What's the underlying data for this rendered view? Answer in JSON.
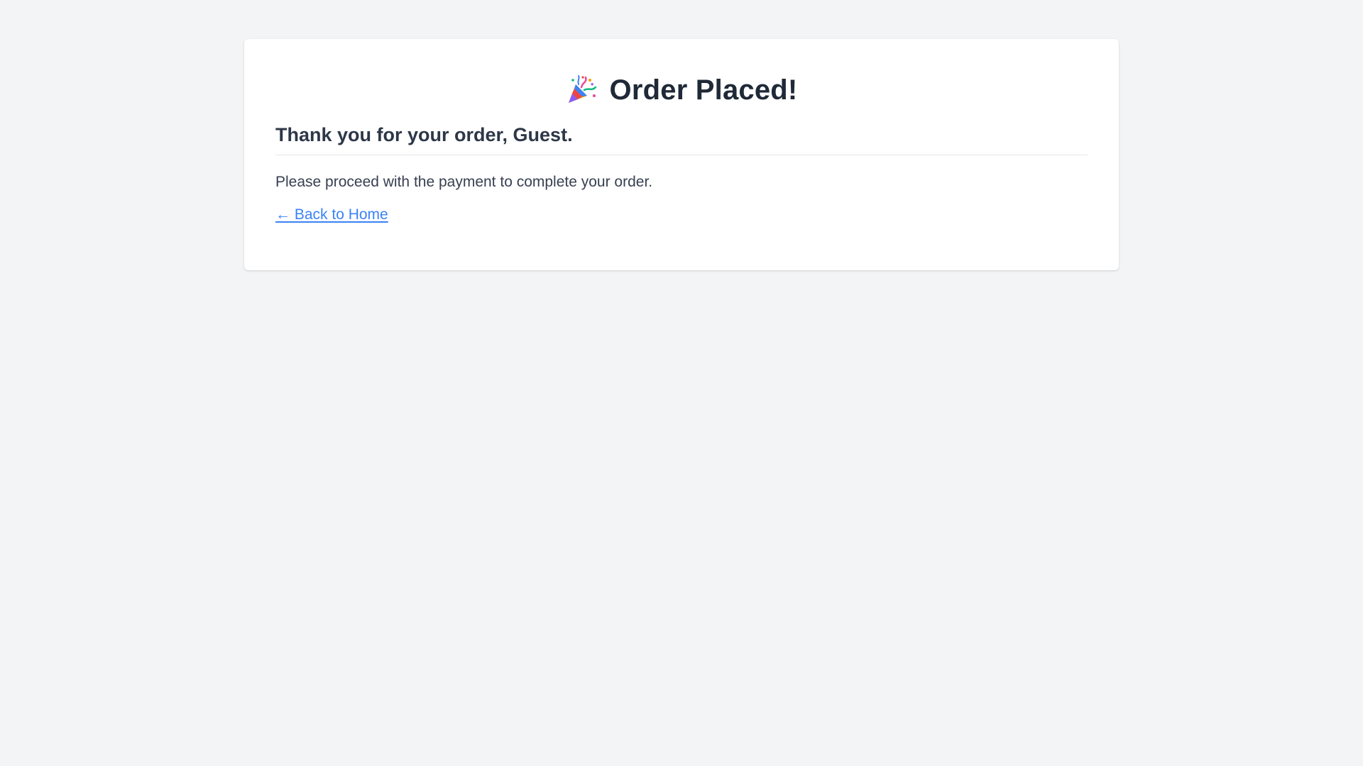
{
  "confirmation": {
    "title_icon": "party-popper-icon",
    "title": "Order Placed!",
    "subtitle": "Thank you for your order, Guest.",
    "message": "Please proceed with the payment to complete your order.",
    "back_link": "← Back to Home"
  },
  "colors": {
    "background": "#f3f4f6",
    "card": "#ffffff",
    "link": "#3b82f6",
    "heading": "#1f2937"
  }
}
